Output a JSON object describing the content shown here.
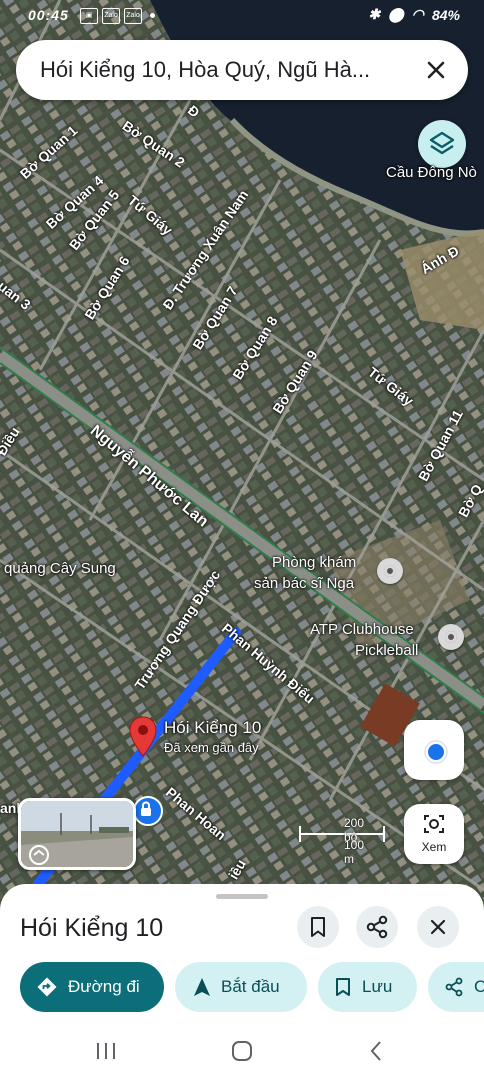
{
  "status_bar": {
    "time": "00:45",
    "icons": [
      "Zalo",
      "Zalo"
    ],
    "battery_text": "84%"
  },
  "search": {
    "query": "Hói Kiểng 10, Hòa Quý, Ngũ Hà..."
  },
  "map": {
    "labels": {
      "cau_dong_no": "Cầu Đông Nò",
      "nguyen_phuoc_lan": "Nguyễn Phước Lan",
      "quang_cay_sung": "quảng Cây Sung",
      "phong_kham_1": "Phòng khám",
      "phong_kham_2": "sản bác sĩ Nga",
      "atp_1": "ATP Clubhouse",
      "atp_2": "Pickleball",
      "bo_quan_1": "Bờ Quan 1",
      "bo_quan_2": "Bờ Quan 2",
      "bo_quan_3": "uan 3",
      "bo_quan_4": "Bờ Quan 4",
      "bo_quan_5": "Bờ Quan 5",
      "bo_quan_6": "Bờ Quan 6",
      "bo_quan_7": "Bờ Quan 7",
      "bo_quan_8": "Bờ Quan 8",
      "bo_quan_9": "Bờ Quan 9",
      "bo_quan_11": "Bờ Quan 11",
      "bo_quan_edge": "Bờ Q",
      "tu_giay_1": "Tứ Giáy",
      "tu_giay_2": "Tứ Giáy",
      "truong_xuan_nam": "Đ. Trương Xuân Nam",
      "truong_quang_duoc": "Trương Quang Được",
      "phan_huynh_dieu": "Phan Huỳnh Điểu",
      "phan_hoan": "Phan Hoan",
      "anh_d": "Ánh Đ",
      "dieu": "Điều",
      "edge_road": "anh Thông",
      "bottom_dieu": "iều",
      "top_d": "Đ"
    },
    "pin": {
      "title": "Hói Kiểng 10",
      "subtitle": "Đã xem gần đây"
    },
    "scale": {
      "top": "200 bộ",
      "bottom": "100 m"
    },
    "xem_label": "Xem"
  },
  "sheet": {
    "title": "Hói Kiểng 10",
    "chips": {
      "directions": "Đường đi",
      "start": "Bắt đầu",
      "save": "Lưu",
      "share": "C"
    }
  },
  "colors": {
    "accent": "#0b6e79",
    "chip_bg": "#d3f1f3",
    "route": "#1f5cff",
    "pin": "#e53935"
  }
}
